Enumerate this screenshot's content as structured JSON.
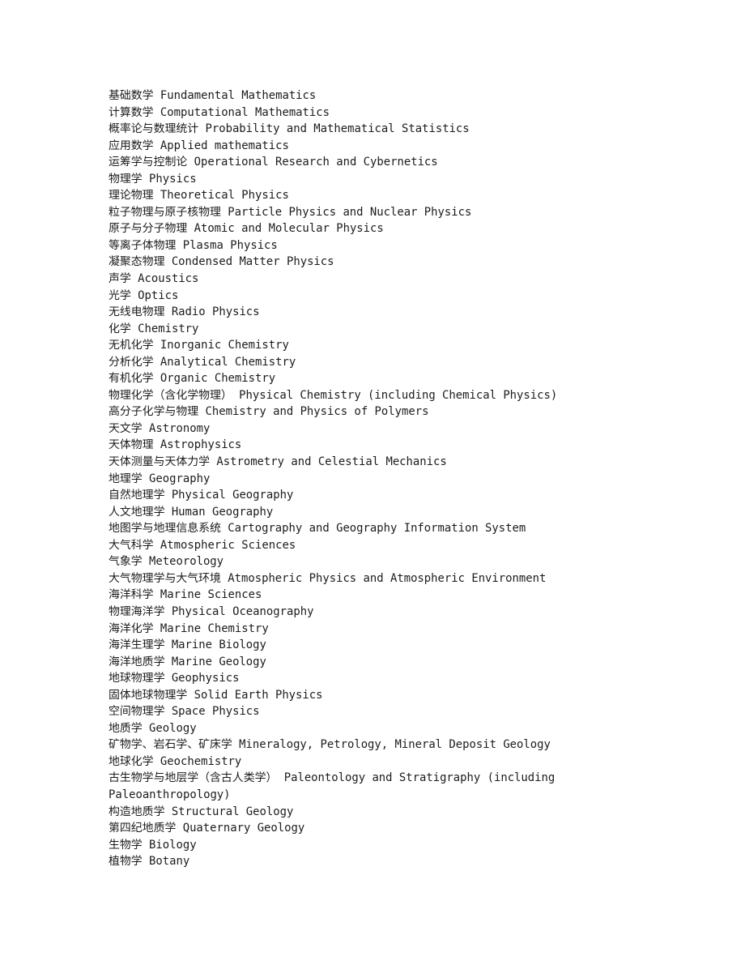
{
  "document": {
    "type": "discipline-name-list",
    "entry_separator": " ",
    "lines": [
      "基础数学 Fundamental Mathematics",
      "计算数学 Computational Mathematics",
      "概率论与数理统计 Probability and Mathematical Statistics",
      "应用数学 Applied mathematics",
      "运筹学与控制论 Operational Research and Cybernetics",
      "物理学 Physics",
      "理论物理 Theoretical Physics",
      "粒子物理与原子核物理 Particle Physics and Nuclear Physics",
      "原子与分子物理 Atomic and Molecular Physics",
      "等离子体物理 Plasma Physics",
      "凝聚态物理 Condensed Matter Physics",
      "声学 Acoustics",
      "光学 Optics",
      "无线电物理 Radio Physics",
      "化学 Chemistry",
      "无机化学 Inorganic Chemistry",
      "分析化学 Analytical Chemistry",
      "有机化学 Organic Chemistry",
      "物理化学（含化学物理） Physical Chemistry (including Chemical Physics)",
      "高分子化学与物理 Chemistry and Physics of Polymers",
      "天文学 Astronomy",
      "天体物理 Astrophysics",
      "天体测量与天体力学 Astrometry and Celestial Mechanics",
      "地理学 Geography",
      "自然地理学 Physical Geography",
      "人文地理学 Human Geography",
      "地图学与地理信息系统 Cartography and Geography Information System",
      "大气科学 Atmospheric Sciences",
      "气象学 Meteorology",
      "大气物理学与大气环境 Atmospheric Physics and Atmospheric Environment",
      "海洋科学 Marine Sciences",
      "物理海洋学 Physical Oceanography",
      "海洋化学 Marine Chemistry",
      "海洋生理学 Marine Biology",
      "海洋地质学 Marine Geology",
      "地球物理学 Geophysics",
      "固体地球物理学 Solid Earth Physics",
      "空间物理学 Space Physics",
      "地质学 Geology",
      "矿物学、岩石学、矿床学 Mineralogy, Petrology, Mineral Deposit Geology",
      "地球化学 Geochemistry",
      "古生物学与地层学（含古人类学） Paleontology and Stratigraphy (including Paleoanthropology)",
      "构造地质学 Structural Geology",
      "第四纪地质学 Quaternary Geology",
      "生物学 Biology",
      "植物学 Botany"
    ]
  }
}
